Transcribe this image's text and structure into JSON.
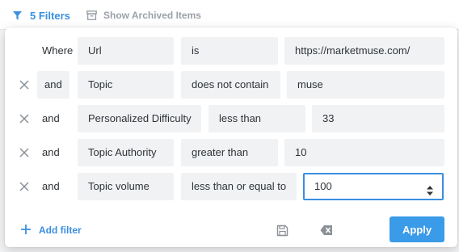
{
  "toolbar": {
    "filters_label": "5 Filters",
    "archived_label": "Show Archived Items"
  },
  "filters": [
    {
      "conjunction": "Where",
      "field": "Url",
      "operator": "is",
      "value": "https://marketmuse.com/"
    },
    {
      "conjunction": "and",
      "field": "Topic",
      "operator": "does not contain",
      "value": "muse"
    },
    {
      "conjunction": "and",
      "field": "Personalized Difficulty",
      "operator": "less than",
      "value": "33"
    },
    {
      "conjunction": "and",
      "field": "Topic Authority",
      "operator": "greater than",
      "value": "10"
    },
    {
      "conjunction": "and",
      "field": "Topic volume",
      "operator": "less than or equal to",
      "value": "100"
    }
  ],
  "footer": {
    "add_filter_label": "Add filter",
    "apply_label": "Apply"
  },
  "colors": {
    "accent": "#3a8fe0",
    "apply_bg": "#3a9be8",
    "field_bg": "#f1f2f4",
    "text": "#2e3338",
    "muted": "#9aa1a8"
  },
  "icons": {
    "filters": "funnel-icon",
    "archived": "archive-box-icon",
    "remove": "close-x-icon",
    "add": "plus-icon",
    "save": "floppy-disk-icon",
    "clear": "backspace-clear-icon",
    "stepper": "up-down-stepper-icon"
  }
}
